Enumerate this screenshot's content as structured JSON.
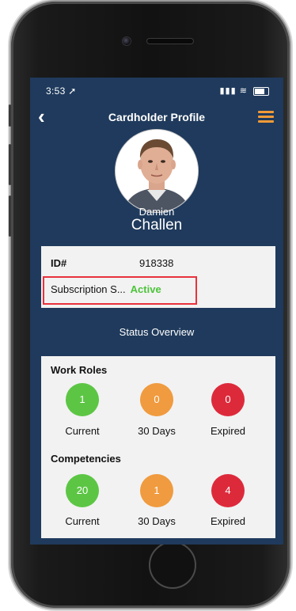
{
  "status_bar": {
    "time": "3:53",
    "icons": "▮▮▮ ≋"
  },
  "nav": {
    "back_icon": "chevron-left-icon",
    "title": "Cardholder Profile",
    "menu_icon": "hamburger-menu-icon"
  },
  "profile": {
    "first_name": "Damien",
    "last_name": "Challen"
  },
  "details": {
    "id_label": "ID#",
    "id_value": "918338",
    "subscription_label": "Subscription S...",
    "subscription_status": "Active"
  },
  "overview": {
    "title": "Status Overview",
    "work_roles": {
      "label": "Work Roles",
      "items": [
        {
          "value": "1",
          "label": "Current",
          "color": "#5cc644"
        },
        {
          "value": "0",
          "label": "30 Days",
          "color": "#f09b3f"
        },
        {
          "value": "0",
          "label": "Expired",
          "color": "#dd2a3b"
        }
      ]
    },
    "competencies": {
      "label": "Competencies",
      "items": [
        {
          "value": "20",
          "label": "Current",
          "color": "#5cc644"
        },
        {
          "value": "1",
          "label": "30 Days",
          "color": "#f09b3f"
        },
        {
          "value": "4",
          "label": "Expired",
          "color": "#dd2a3b"
        }
      ]
    }
  },
  "colors": {
    "screen_bg": "#1f3a5c",
    "accent": "#f29b38",
    "highlight": "#e8323c",
    "active": "#4cc33a"
  }
}
